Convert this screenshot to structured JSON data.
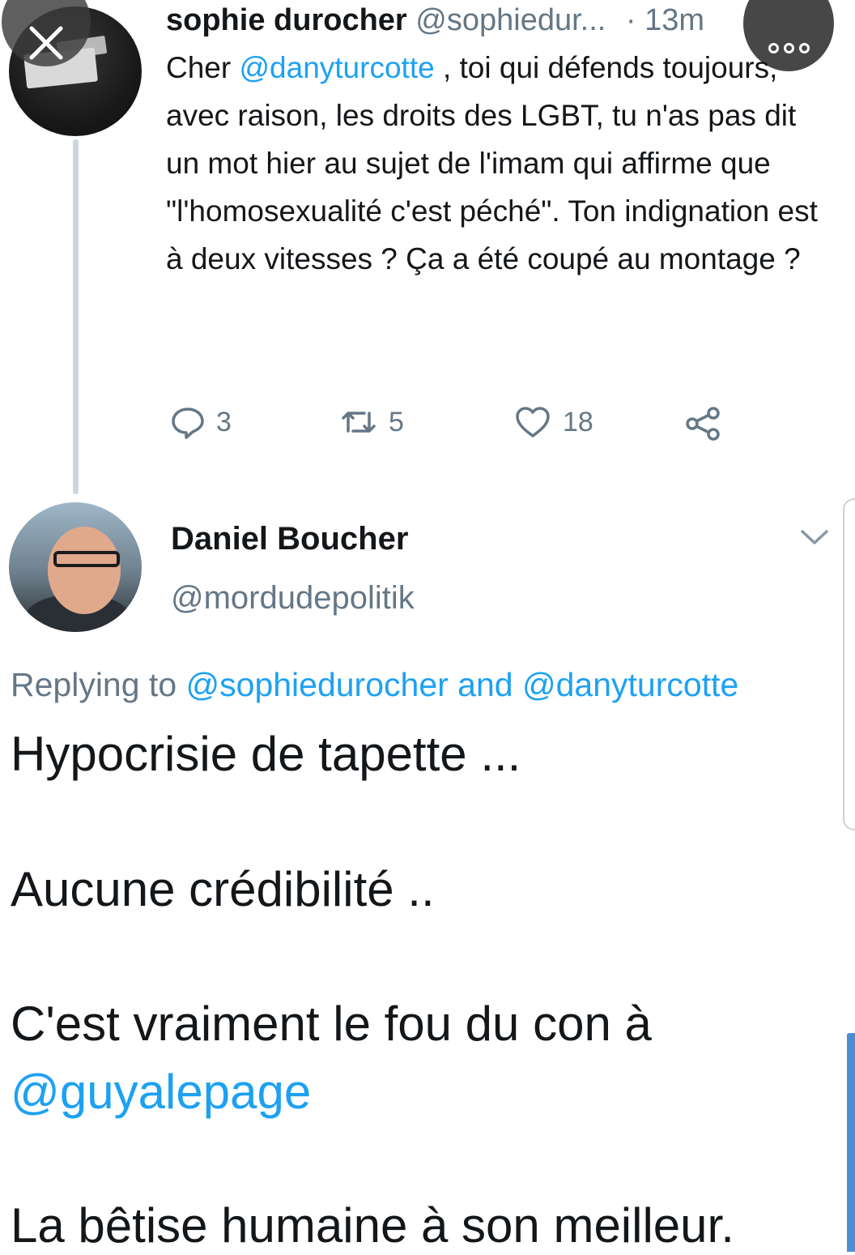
{
  "tweet1": {
    "name": "sophie durocher",
    "handle": "@sophiedur...",
    "time": "· 13m",
    "text_prefix": "Cher ",
    "mention": "@danyturcotte",
    "text_rest": " , toi qui défends toujours, avec raison,  les droits des LGBT, tu n'as pas dit un mot hier au sujet de l'imam qui affirme que \"l'homosexualité c'est péché\". Ton indignation est à deux vitesses ? Ça a été coupé au montage ?",
    "replies": "3",
    "retweets": "5",
    "likes": "18"
  },
  "tweet2": {
    "name": "Daniel Boucher",
    "handle": "@mordudepolitik",
    "replying_label": "Replying to ",
    "replying_mention1": "@sophiedurocher",
    "replying_and": " and ",
    "replying_mention2": "@danyturcotte",
    "line1": "Hypocrisie de tapette ...",
    "line2": "Aucune crédibilité ..",
    "line3": "C'est vraiment le fou du con à",
    "line3_mention": "@guyalepage",
    "line4": "La bêtise humaine à son meilleur."
  },
  "icons": {
    "close": "close-icon",
    "more": "more-dots-icon",
    "reply": "reply-icon",
    "retweet": "retweet-icon",
    "like": "heart-icon",
    "share": "share-icon",
    "chevron": "chevron-down-icon"
  },
  "colors": {
    "link": "#1da1f2",
    "muted": "#657786",
    "text": "#14171a"
  }
}
